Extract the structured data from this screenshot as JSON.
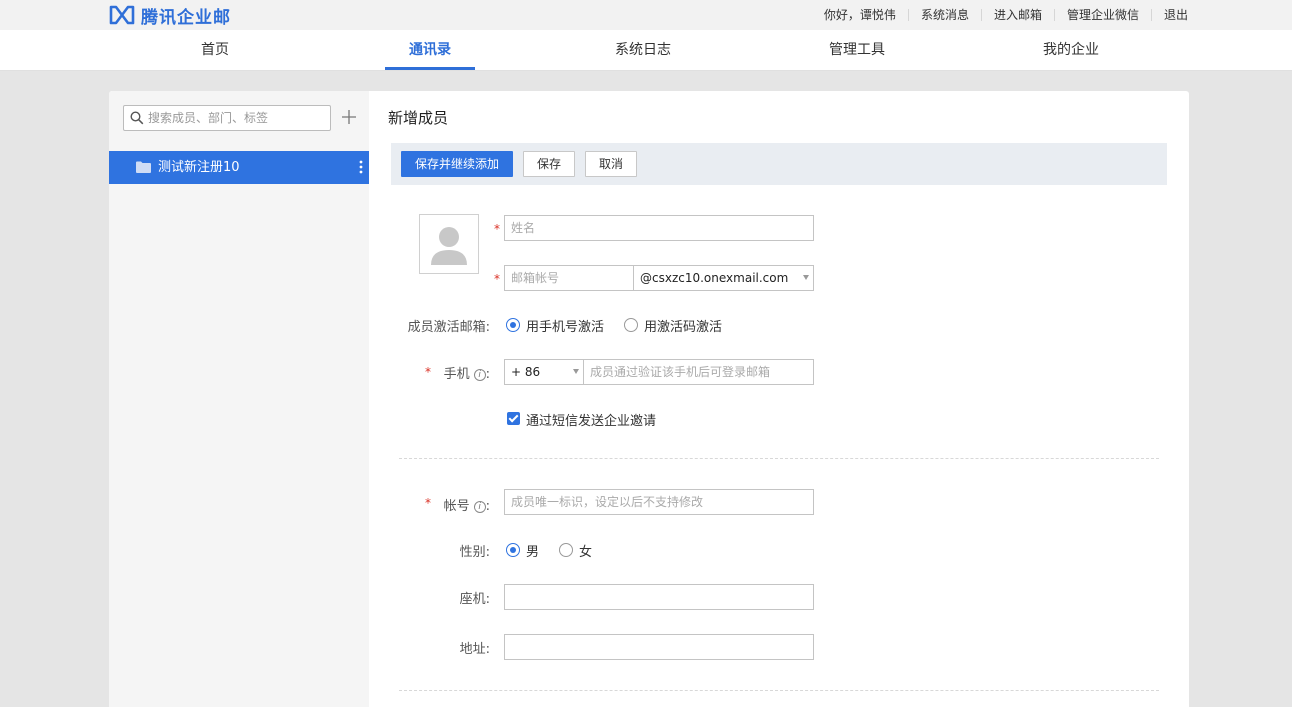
{
  "brand": {
    "name": "腾讯企业邮",
    "color": "#2f6fd8"
  },
  "toplinks": [
    "你好，谭悦伟",
    "系统消息",
    "进入邮箱",
    "管理企业微信",
    "退出"
  ],
  "nav": {
    "items": [
      "首页",
      "通讯录",
      "系统日志",
      "管理工具",
      "我的企业"
    ],
    "active": "通讯录"
  },
  "sidebar": {
    "search_placeholder": "搜索成员、部门、标签",
    "departments": [
      {
        "label": "测试新注册10",
        "selected": true
      }
    ]
  },
  "main": {
    "title": "新增成员",
    "toolbar": {
      "save_continue": "保存并继续添加",
      "save": "保存",
      "cancel": "取消"
    },
    "name_placeholder": "姓名",
    "email_placeholder": "邮箱帐号",
    "email_domain": "@csxzc10.onexmail.com",
    "activation": {
      "label": "成员激活邮箱:",
      "options": [
        "用手机号激活",
        "用激活码激活"
      ],
      "selected": "用手机号激活"
    },
    "phone": {
      "label": "手机",
      "colon": ":",
      "country_code": "+ 86",
      "placeholder": "成员通过验证该手机后可登录邮箱"
    },
    "sms_invite": {
      "label": "通过短信发送企业邀请",
      "checked": true
    },
    "account": {
      "label": "帐号",
      "colon": ":",
      "placeholder": "成员唯一标识，设定以后不支持修改"
    },
    "gender": {
      "label": "性别:",
      "options": [
        "男",
        "女"
      ],
      "selected": "男"
    },
    "landline": {
      "label": "座机:",
      "value": ""
    },
    "address": {
      "label": "地址:",
      "value": ""
    }
  },
  "colors": {
    "accent": "#2f73e0",
    "required": "#d93025"
  }
}
